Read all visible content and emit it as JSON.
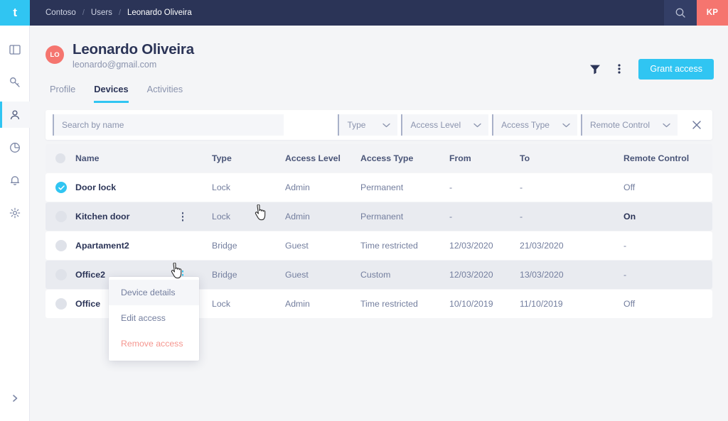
{
  "brand": {
    "logo_letter": "t",
    "accent": "#30c5f2",
    "dark": "#2b3457",
    "coral": "#f5756f"
  },
  "topbar": {
    "breadcrumb": [
      "Contoso",
      "Users",
      "Leonardo Oliveira"
    ],
    "separator": "/",
    "search_icon": "search-icon",
    "account_initials": "KP"
  },
  "sidebar": {
    "items": [
      {
        "name": "sidebar-item-dashboard",
        "icon": "layout-panel-icon",
        "active": false
      },
      {
        "name": "sidebar-item-keys",
        "icon": "key-icon",
        "active": false
      },
      {
        "name": "sidebar-item-users",
        "icon": "user-icon",
        "active": true
      },
      {
        "name": "sidebar-item-analytics",
        "icon": "pie-chart-icon",
        "active": false
      },
      {
        "name": "sidebar-item-notifications",
        "icon": "bell-icon",
        "active": false
      },
      {
        "name": "sidebar-item-settings",
        "icon": "gear-icon",
        "active": false
      }
    ],
    "expand_icon": "chevron-right-icon"
  },
  "user": {
    "initials": "LO",
    "name": "Leonardo Oliveira",
    "email": "leonardo@gmail.com"
  },
  "header_actions": {
    "filter_icon": "filter-funnel-icon",
    "more_icon": "more-vertical-icon",
    "grant_label": "Grant access"
  },
  "tabs": [
    {
      "label": "Profile",
      "active": false
    },
    {
      "label": "Devices",
      "active": true
    },
    {
      "label": "Activities",
      "active": false
    }
  ],
  "filters": {
    "search_placeholder": "Search by name",
    "search_value": "",
    "selects": [
      {
        "label": "Type",
        "name": "filter-type"
      },
      {
        "label": "Access Level",
        "name": "filter-access-level"
      },
      {
        "label": "Access Type",
        "name": "filter-access-type"
      },
      {
        "label": "Remote Control",
        "name": "filter-remote-control"
      }
    ],
    "clear_icon": "close-icon"
  },
  "table": {
    "columns": [
      "Name",
      "Type",
      "Access Level",
      "Access Type",
      "From",
      "To",
      "Remote Control"
    ],
    "rows": [
      {
        "name": "Door lock",
        "type": "Lock",
        "access_level": "Admin",
        "access_type": "Permanent",
        "from": "-",
        "to": "-",
        "remote": "Off",
        "selected": true,
        "alt": false,
        "remote_strong": false
      },
      {
        "name": "Kitchen door",
        "type": "Lock",
        "access_level": "Admin",
        "access_type": "Permanent",
        "from": "-",
        "to": "-",
        "remote": "On",
        "selected": false,
        "alt": true,
        "remote_strong": true
      },
      {
        "name": "Apartament2",
        "type": "Bridge",
        "access_level": "Guest",
        "access_type": "Time restricted",
        "from": "12/03/2020",
        "to": "21/03/2020",
        "remote": "-",
        "selected": false,
        "alt": false,
        "remote_strong": false
      },
      {
        "name": "Office2",
        "type": "Bridge",
        "access_level": "Guest",
        "access_type": "Custom",
        "from": "12/03/2020",
        "to": "13/03/2020",
        "remote": "-",
        "selected": false,
        "alt": true,
        "remote_strong": false
      },
      {
        "name": "Office",
        "type": "Lock",
        "access_level": "Admin",
        "access_type": "Time restricted",
        "from": "10/10/2019",
        "to": "11/10/2019",
        "remote": "Off",
        "selected": false,
        "alt": false,
        "remote_strong": false
      }
    ]
  },
  "context_menu": {
    "items": [
      {
        "label": "Device details",
        "highlighted": true,
        "danger": false
      },
      {
        "label": "Edit access",
        "highlighted": false,
        "danger": false
      },
      {
        "label": "Remove access",
        "highlighted": false,
        "danger": true
      }
    ]
  }
}
